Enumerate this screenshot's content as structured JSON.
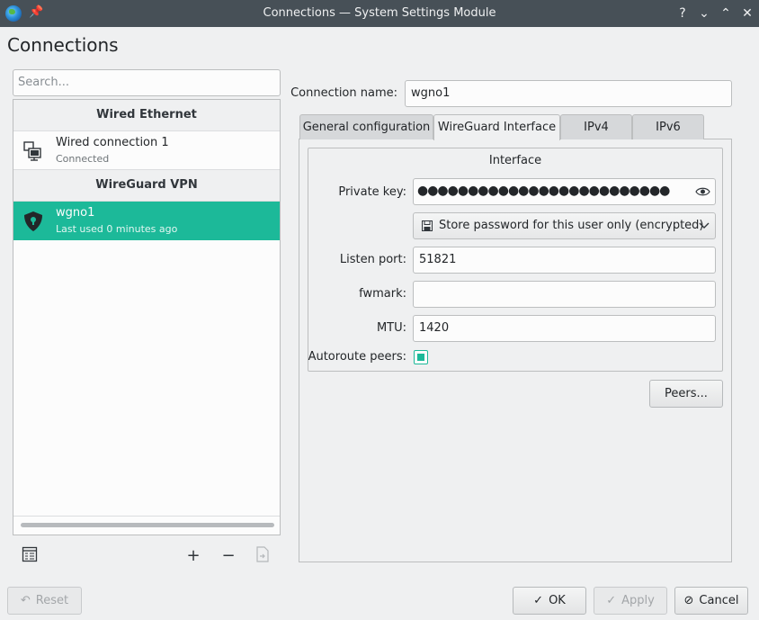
{
  "window": {
    "title": "Connections — System Settings Module",
    "controls": [
      "?",
      "⌄",
      "⌃",
      "✕"
    ]
  },
  "page_title": "Connections",
  "search": {
    "placeholder": "Search..."
  },
  "connection_groups": [
    {
      "header": "Wired Ethernet",
      "items": [
        {
          "name": "Wired connection 1",
          "status": "Connected",
          "icon": "wired-network-icon"
        }
      ]
    },
    {
      "header": "WireGuard VPN",
      "items": [
        {
          "name": "wgno1",
          "status": "Last used 0 minutes ago",
          "icon": "vpn-shield-icon",
          "selected": true
        }
      ]
    }
  ],
  "list_toolbar": {
    "add": "+",
    "remove": "−"
  },
  "form": {
    "connection_name_label": "Connection name:",
    "connection_name_value": "wgno1",
    "tabs": [
      "General configuration",
      "WireGuard Interface",
      "IPv4",
      "IPv6"
    ],
    "active_tab": "WireGuard Interface",
    "interface_group_title": "Interface",
    "private_key_label": "Private key:",
    "private_key_masked": "●●●●●●●●●●●●●●●●●●●●●●●●●",
    "password_storage": "Store password for this user only (encrypted)",
    "listen_port_label": "Listen port:",
    "listen_port_value": "51821",
    "fwmark_label": "fwmark:",
    "fwmark_value": "",
    "mtu_label": "MTU:",
    "mtu_value": "1420",
    "autoroute_label": "Autoroute peers:",
    "autoroute_checked": true,
    "peers_button": "Peers..."
  },
  "footer": {
    "reset": "Reset",
    "ok": "OK",
    "apply": "Apply",
    "cancel": "Cancel"
  },
  "colors": {
    "accent": "#1cb999",
    "titlebar": "#475057",
    "background": "#eff0f1"
  }
}
